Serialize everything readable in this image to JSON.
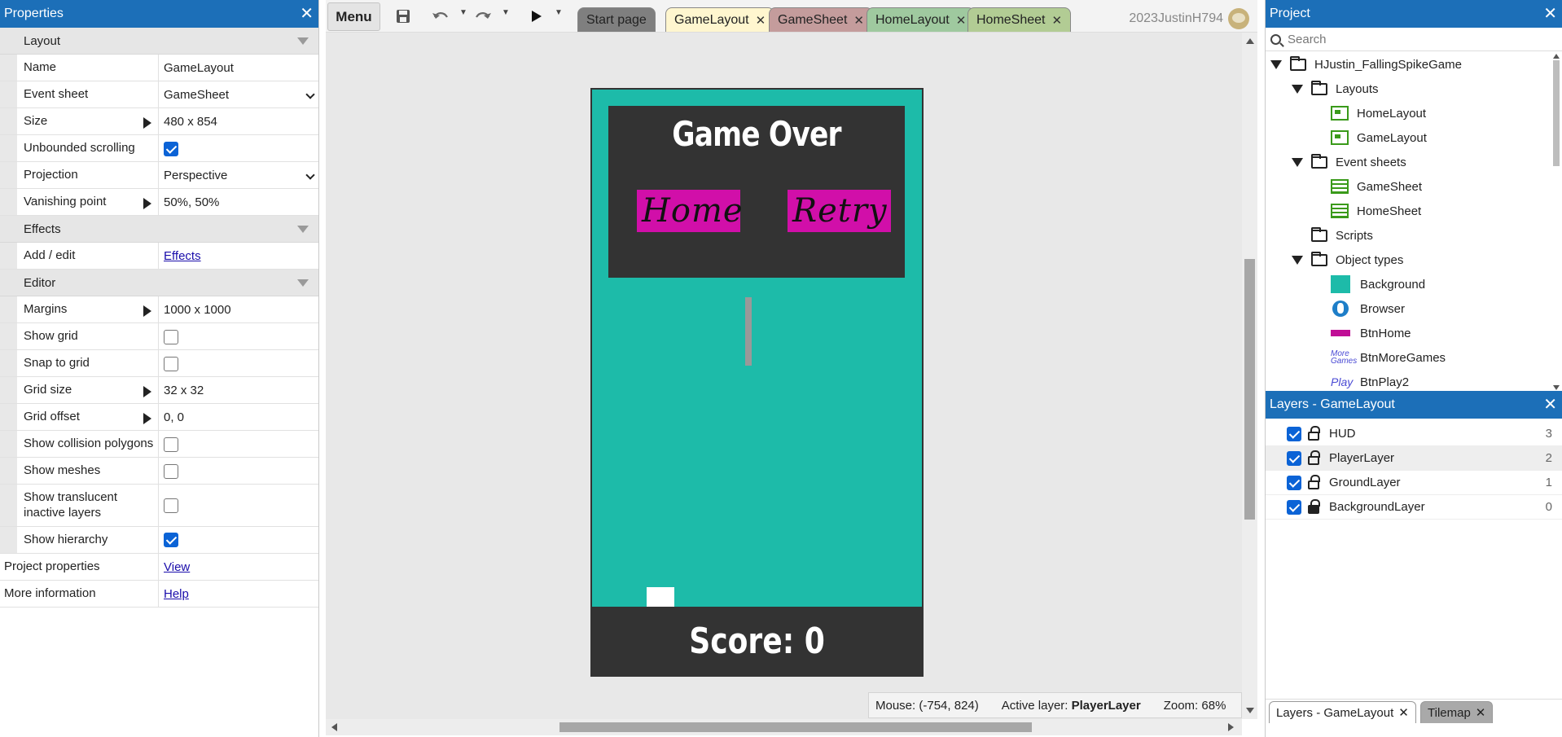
{
  "properties": {
    "title": "Properties",
    "sections": {
      "layout": "Layout",
      "effects": "Effects",
      "editor": "Editor"
    },
    "layout_rows": [
      {
        "name": "Name",
        "value": "GameLayout"
      },
      {
        "name": "Event sheet",
        "value": "GameSheet"
      },
      {
        "name": "Size",
        "value": "480 x 854"
      },
      {
        "name": "Unbounded scrolling",
        "value": true
      },
      {
        "name": "Projection",
        "value": "Perspective"
      },
      {
        "name": "Vanishing point",
        "value": "50%, 50%"
      }
    ],
    "effects_rows": [
      {
        "name": "Add / edit",
        "value": "Effects"
      }
    ],
    "editor_rows": [
      {
        "name": "Margins",
        "value": "1000 x 1000"
      },
      {
        "name": "Show grid",
        "value": false
      },
      {
        "name": "Snap to grid",
        "value": false
      },
      {
        "name": "Grid size",
        "value": "32 x 32"
      },
      {
        "name": "Grid offset",
        "value": "0, 0"
      },
      {
        "name": "Show collision polygons",
        "value": false
      },
      {
        "name": "Show meshes",
        "value": false
      },
      {
        "name": "Show translucent inactive layers",
        "value": false
      },
      {
        "name": "Show hierarchy",
        "value": true
      }
    ],
    "footer_rows": [
      {
        "name": "Project properties",
        "value": "View"
      },
      {
        "name": "More information",
        "value": "Help"
      }
    ]
  },
  "toolbar": {
    "menu_label": "Menu",
    "tabs": [
      {
        "label": "Start page",
        "color": "#7f7f7f"
      },
      {
        "label": "GameLayout",
        "color": "#fff6cf"
      },
      {
        "label": "GameSheet",
        "color": "#c49c9c"
      },
      {
        "label": "HomeLayout",
        "color": "#9fc99f"
      },
      {
        "label": "HomeSheet",
        "color": "#b2cc94"
      }
    ],
    "user": "2023JustinH794"
  },
  "game": {
    "title": "Game Over",
    "home_button": "Home",
    "retry_button": "Retry",
    "score": "Score: 0"
  },
  "status": {
    "mouse_label": "Mouse:",
    "mouse_value": "(-754, 824)",
    "layer_label": "Active layer:",
    "layer_value": "PlayerLayer",
    "zoom_label": "Zoom:",
    "zoom_value": "68%"
  },
  "project": {
    "title": "Project",
    "search_placeholder": "Search",
    "root": "HJustin_FallingSpikeGame",
    "layouts_folder": "Layouts",
    "layouts": [
      "HomeLayout",
      "GameLayout"
    ],
    "eventsheets_folder": "Event sheets",
    "eventsheets": [
      "GameSheet",
      "HomeSheet"
    ],
    "scripts_folder": "Scripts",
    "objecttypes_folder": "Object types",
    "objects": [
      "Background",
      "Browser",
      "BtnHome",
      "BtnMoreGames",
      "BtnPlay2"
    ]
  },
  "layers": {
    "title": "Layers - GameLayout",
    "items": [
      {
        "name": "HUD",
        "index": "3"
      },
      {
        "name": "PlayerLayer",
        "index": "2"
      },
      {
        "name": "GroundLayer",
        "index": "1"
      },
      {
        "name": "BackgroundLayer",
        "index": "0"
      }
    ]
  },
  "bottom_tabs": [
    "Layers - GameLayout",
    "Tilemap"
  ],
  "colors": {
    "accent": "#1c6fb8",
    "game_bg": "#1dbba9",
    "game_dark": "#333333",
    "button_pink": "#d10fa9"
  }
}
